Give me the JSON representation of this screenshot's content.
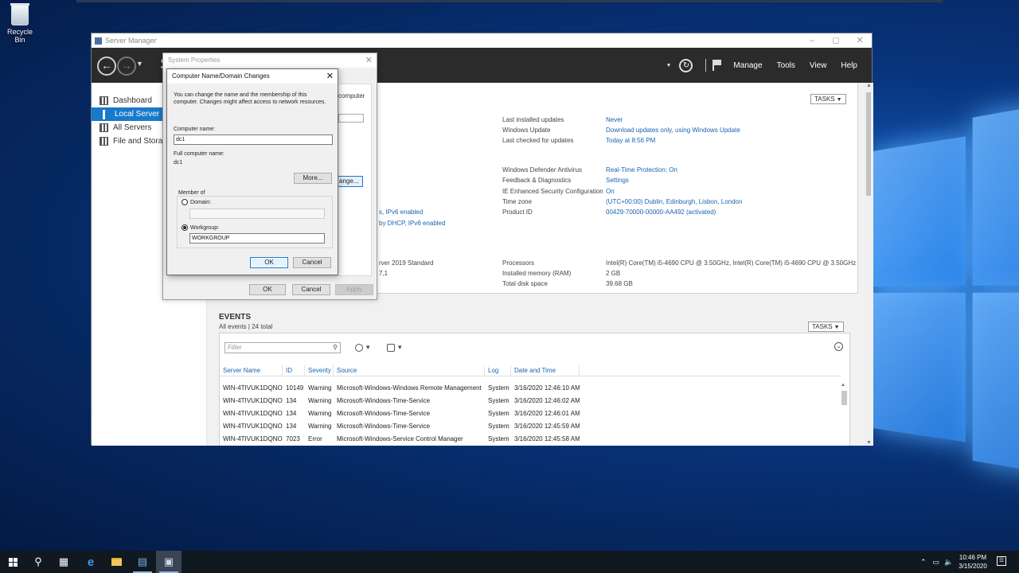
{
  "desktop": {
    "recycle_bin_label": "Recycle Bin"
  },
  "server_manager": {
    "title": "Server Manager",
    "crumb_fragment": "S",
    "menu": [
      "Manage",
      "Tools",
      "View",
      "Help"
    ],
    "sidebar": [
      {
        "label": "Dashboard",
        "selected": false
      },
      {
        "label": "Local Server",
        "selected": true
      },
      {
        "label": "All Servers",
        "selected": false
      },
      {
        "label": "File and Storage",
        "selected": false
      }
    ],
    "tasks_label": "TASKS",
    "properties": {
      "right_top": [
        {
          "label": "Last installed updates",
          "value": "Never"
        },
        {
          "label": "Windows Update",
          "value": "Download updates only, using Windows Update"
        },
        {
          "label": "Last checked for updates",
          "value": "Today at 8:56 PM"
        }
      ],
      "right_mid": [
        {
          "label": "Windows Defender Antivirus",
          "value": "Real-Time Protection: On"
        },
        {
          "label": "Feedback & Diagnostics",
          "value": "Settings"
        },
        {
          "label": "IE Enhanced Security Configuration",
          "value": "On"
        },
        {
          "label": "Time zone",
          "value": "(UTC+00:00) Dublin, Edinburgh, Lisbon, London"
        },
        {
          "label": "Product ID",
          "value": "00429-70000-00000-AA492 (activated)"
        }
      ],
      "right_bottom": [
        {
          "label": "Processors",
          "value": "Intel(R) Core(TM) i5-4690 CPU @ 3.50GHz, Intel(R) Core(TM) i5-4690 CPU @ 3.50GHz"
        },
        {
          "label": "Installed memory (RAM)",
          "value": "2 GB"
        },
        {
          "label": "Total disk space",
          "value": "39.68 GB"
        }
      ],
      "left_fragments": {
        "computer": "computer",
        "ipv6_enabled": "s, IPv6 enabled",
        "dhcp": "by DHCP, IPv6 enabled",
        "os": "rver 2019 Standard",
        "ver": "7,1"
      }
    },
    "events": {
      "title": "EVENTS",
      "subtitle": "All events | 24 total",
      "filter_placeholder": "Filter",
      "columns": [
        "Server Name",
        "ID",
        "Severity",
        "Source",
        "Log",
        "Date and Time"
      ],
      "rows": [
        [
          "WIN-4TIVUK1DQNO",
          "10149",
          "Warning",
          "Microsoft-Windows-Windows Remote Management",
          "System",
          "3/16/2020 12:46:10 AM"
        ],
        [
          "WIN-4TIVUK1DQNO",
          "134",
          "Warning",
          "Microsoft-Windows-Time-Service",
          "System",
          "3/16/2020 12:46:02 AM"
        ],
        [
          "WIN-4TIVUK1DQNO",
          "134",
          "Warning",
          "Microsoft-Windows-Time-Service",
          "System",
          "3/16/2020 12:46:01 AM"
        ],
        [
          "WIN-4TIVUK1DQNO",
          "134",
          "Warning",
          "Microsoft-Windows-Time-Service",
          "System",
          "3/16/2020 12:45:59 AM"
        ],
        [
          "WIN-4TIVUK1DQNO",
          "7023",
          "Error",
          "Microsoft-Windows-Service Control Manager",
          "System",
          "3/16/2020 12:45:58 AM"
        ]
      ]
    }
  },
  "system_properties": {
    "title": "System Properties",
    "change_fragment": "ange...",
    "ok_label": "OK",
    "cancel_label": "Cancel",
    "apply_label": "Apply"
  },
  "name_change_dialog": {
    "title": "Computer Name/Domain Changes",
    "description": "You can change the name and the membership of this computer. Changes might affect access to network resources.",
    "computer_name_label": "Computer name:",
    "computer_name_value": "dc1",
    "full_name_label": "Full computer name:",
    "full_name_value": "dc1",
    "more_label": "More...",
    "member_of_label": "Member of",
    "domain_label": "Domain:",
    "domain_value": "",
    "workgroup_label": "Workgroup:",
    "workgroup_value": "WORKGROUP",
    "selected_membership": "workgroup",
    "ok_label": "OK",
    "cancel_label": "Cancel"
  },
  "taskbar": {
    "clock_time": "10:46 PM",
    "clock_date": "3/15/2020",
    "icons": [
      "start-icon",
      "search-icon",
      "task-view-icon",
      "edge-icon",
      "file-explorer-icon",
      "server-manager-icon",
      "system-properties-icon"
    ]
  },
  "colors": {
    "accent": "#1979ca",
    "link": "#1a64b3",
    "header_bg": "#2b2b2b"
  }
}
